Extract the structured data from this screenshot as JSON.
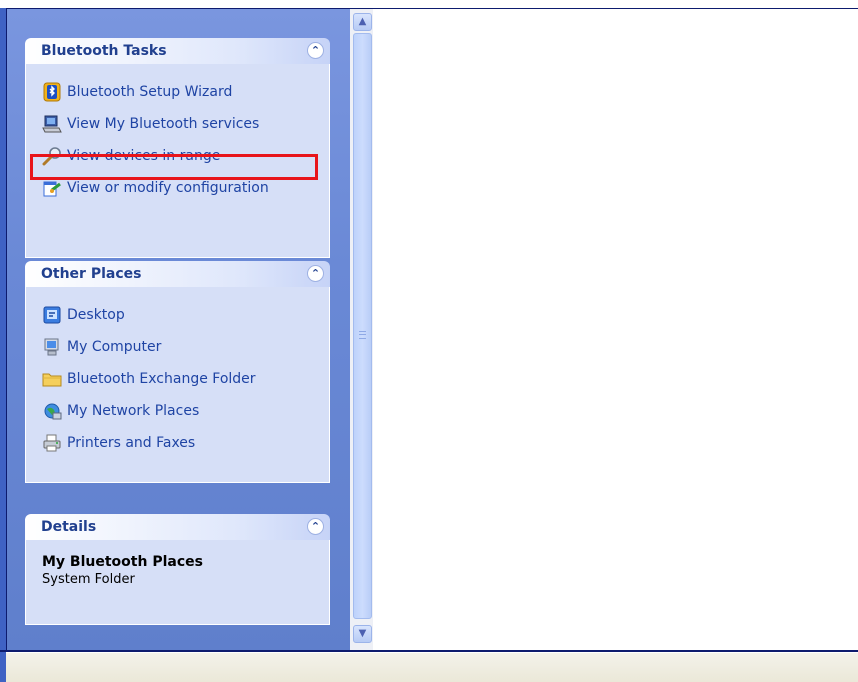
{
  "task_groups": [
    {
      "title": "Bluetooth Tasks",
      "collapse_glyph": "⌃",
      "items": [
        {
          "label": "Bluetooth Setup Wizard",
          "icon": "bluetooth-wizard-icon"
        },
        {
          "label": "View My Bluetooth services",
          "icon": "bluetooth-services-icon"
        },
        {
          "label": "View devices in range",
          "icon": "magnifier-icon"
        },
        {
          "label": "View or modify configuration",
          "icon": "configuration-icon"
        }
      ]
    },
    {
      "title": "Other Places",
      "collapse_glyph": "⌃",
      "items": [
        {
          "label": "Desktop",
          "icon": "desktop-icon"
        },
        {
          "label": "My Computer",
          "icon": "my-computer-icon"
        },
        {
          "label": "Bluetooth Exchange Folder",
          "icon": "folder-icon"
        },
        {
          "label": "My Network Places",
          "icon": "network-places-icon"
        },
        {
          "label": "Printers and Faxes",
          "icon": "printer-icon"
        }
      ]
    },
    {
      "title": "Details",
      "collapse_glyph": "⌃",
      "name": "My Bluetooth Places",
      "type": "System Folder"
    }
  ],
  "scrollbar": {
    "up": "▲",
    "down": "▼"
  },
  "colors": {
    "highlight": "#e8141b",
    "pane": "#6a89d6",
    "link": "#1f44a4"
  }
}
